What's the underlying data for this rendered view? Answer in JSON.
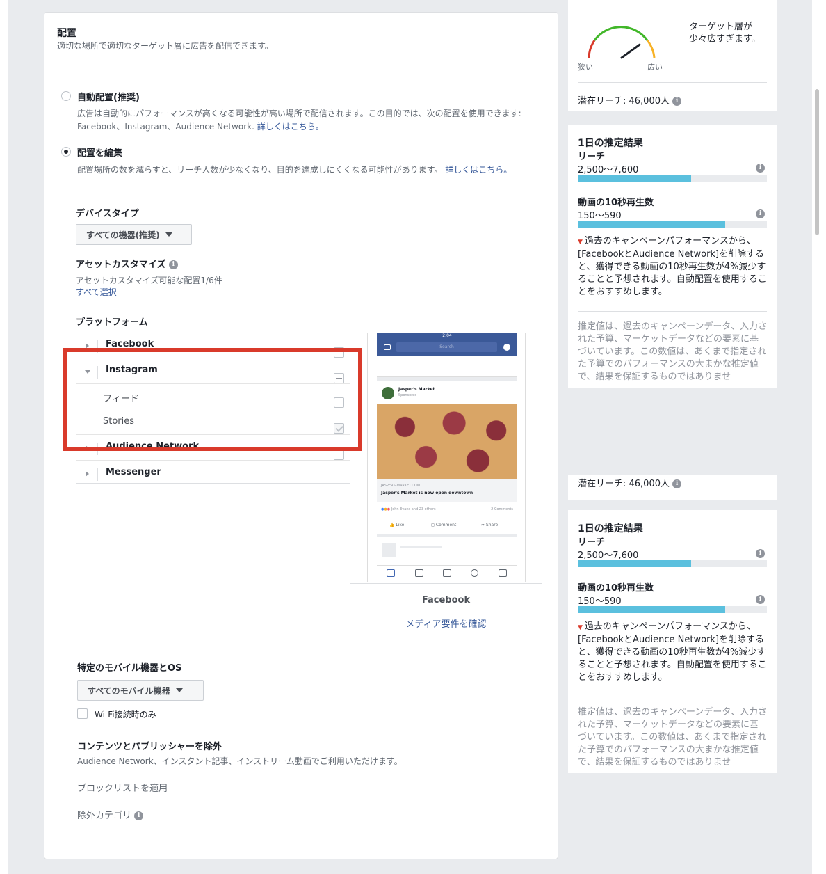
{
  "placement": {
    "title": "配置",
    "subtitle": "適切な場所で適切なターゲット層に広告を配信できます。",
    "auto": {
      "label": "自動配置(推奨)",
      "desc": "広告は自動的にパフォーマンスが高くなる可能性が高い場所で配信されます。この目的では、次の配置を使用できます: Facebook、Instagram、Audience Network.",
      "link": "詳しくはこちら。"
    },
    "edit": {
      "label": "配置を編集",
      "desc": "配置場所の数を減らすと、リーチ人数が少なくなり、目的を達成しにくくなる可能性があります。",
      "link_a": "詳しくはこ",
      "link_b": "ちら。"
    },
    "device_type": {
      "label": "デバイスタイプ",
      "value": "すべての機器(推奨)"
    },
    "asset": {
      "label": "アセットカスタマイズ",
      "count": "アセットカスタマイズ可能な配置1/6件",
      "select_all": "すべて選択"
    },
    "platform": {
      "label": "プラットフォーム",
      "facebook": "Facebook",
      "instagram": "Instagram",
      "feed": "フィード",
      "stories": "Stories",
      "audience_network": "Audience Network",
      "messenger": "Messenger"
    },
    "preview": {
      "caption": "Facebook",
      "media_link": "メディア要件を確認",
      "phone_time": "2:04",
      "search": "Search",
      "advertiser": "Jasper's Market",
      "sponsored": "Sponsored",
      "domain": "JASPERS-MARKET.COM",
      "headline": "Jasper's Market is now open downtown",
      "reactions": "John Evans and 23 others",
      "comments": "2 Comments",
      "like": "Like",
      "comment": "Comment",
      "share": "Share"
    },
    "mobile": {
      "label": "特定のモバイル機器とOS",
      "value": "すべてのモバイル機器",
      "wifi": "Wi-Fi接続時のみ"
    },
    "exclude": {
      "label": "コンテンツとパブリッシャーを除外",
      "desc": "Audience Network、インスタント記事、インストリーム動画でご利用いただけます。",
      "blocklist": "ブロックリストを適用",
      "categories": "除外カテゴリ"
    }
  },
  "side": {
    "gauge": {
      "message": "ターゲット層が少々広すぎます。",
      "narrow": "狭い",
      "wide": "広い",
      "level": 0.8
    },
    "potential_reach": "潜在リーチ: 46,000人",
    "estimate": {
      "title": "1日の推定結果",
      "reach_label": "リーチ",
      "reach_value": "2,500〜7,600",
      "reach_fill": 0.6,
      "video_label": "動画の10秒再生数",
      "video_value": "150〜590",
      "video_fill": 0.78,
      "warning": "過去のキャンペーンパフォーマンスから、[FacebookとAudience Network]を削除すると、獲得できる動画の10秒再生数が4%減少することと予想されます。自動配置を使用することをおすすめします。",
      "disclaimer": "推定値は、過去のキャンペーンデータ、入力された予算、マーケットデータなどの要素に基づいています。この数値は、あくまで指定された予算でのパフォーマンスの大まかな推定値で、結果を保証するものではありませ"
    }
  },
  "colors": {
    "highlight": "#d93a2b",
    "bar": "#5bc0de",
    "link": "#365899"
  }
}
